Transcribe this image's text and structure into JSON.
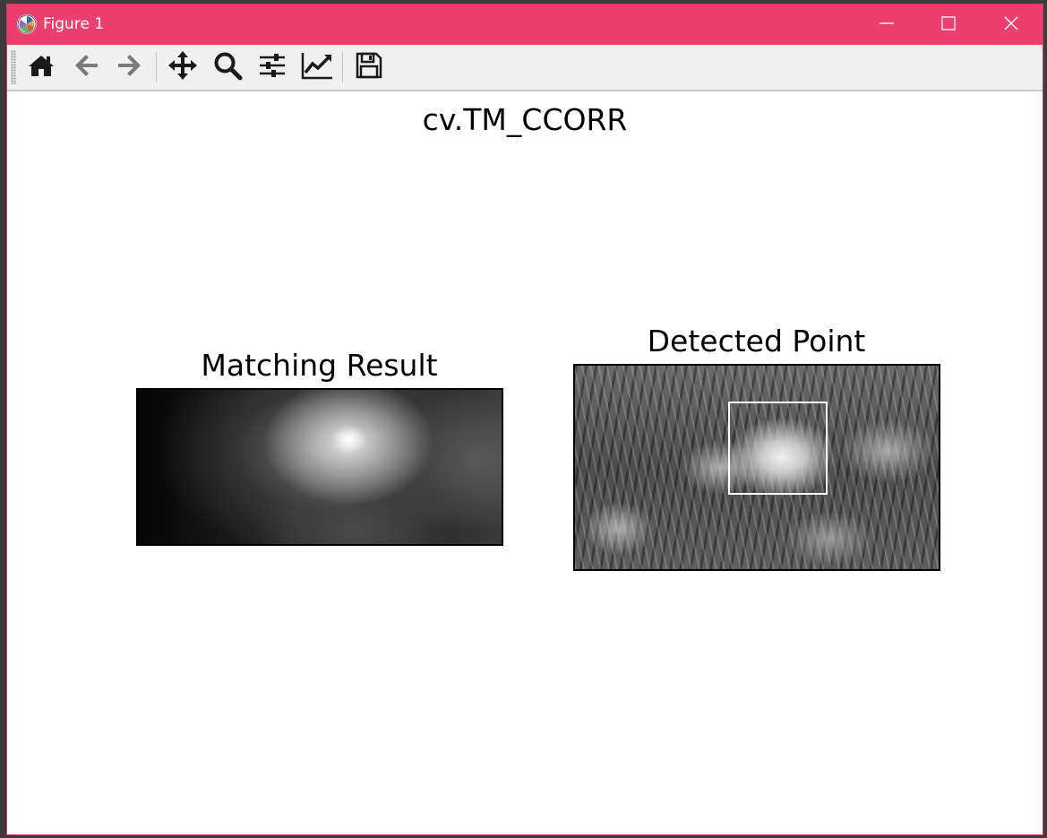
{
  "window": {
    "title": "Figure 1",
    "titlebar_color": "#ec3f70",
    "controls": {
      "minimize_icon": "minimize-icon",
      "maximize_icon": "maximize-icon",
      "close_icon": "close-icon"
    }
  },
  "toolbar": {
    "items": [
      {
        "name": "home",
        "icon": "home-icon"
      },
      {
        "name": "back",
        "icon": "arrow-left-icon"
      },
      {
        "name": "forward",
        "icon": "arrow-right-icon"
      },
      {
        "name": "pan",
        "icon": "move-icon"
      },
      {
        "name": "zoom",
        "icon": "magnifier-icon"
      },
      {
        "name": "configure-subplots",
        "icon": "sliders-icon"
      },
      {
        "name": "edit-axis",
        "icon": "line-chart-icon"
      },
      {
        "name": "save",
        "icon": "floppy-disk-icon"
      }
    ]
  },
  "figure": {
    "suptitle": "cv.TM_CCORR",
    "subplots": [
      {
        "title": "Matching Result",
        "content": "grayscale heatmap"
      },
      {
        "title": "Detected Point",
        "content": "grayscale photograph of flower with white rectangle"
      }
    ]
  }
}
